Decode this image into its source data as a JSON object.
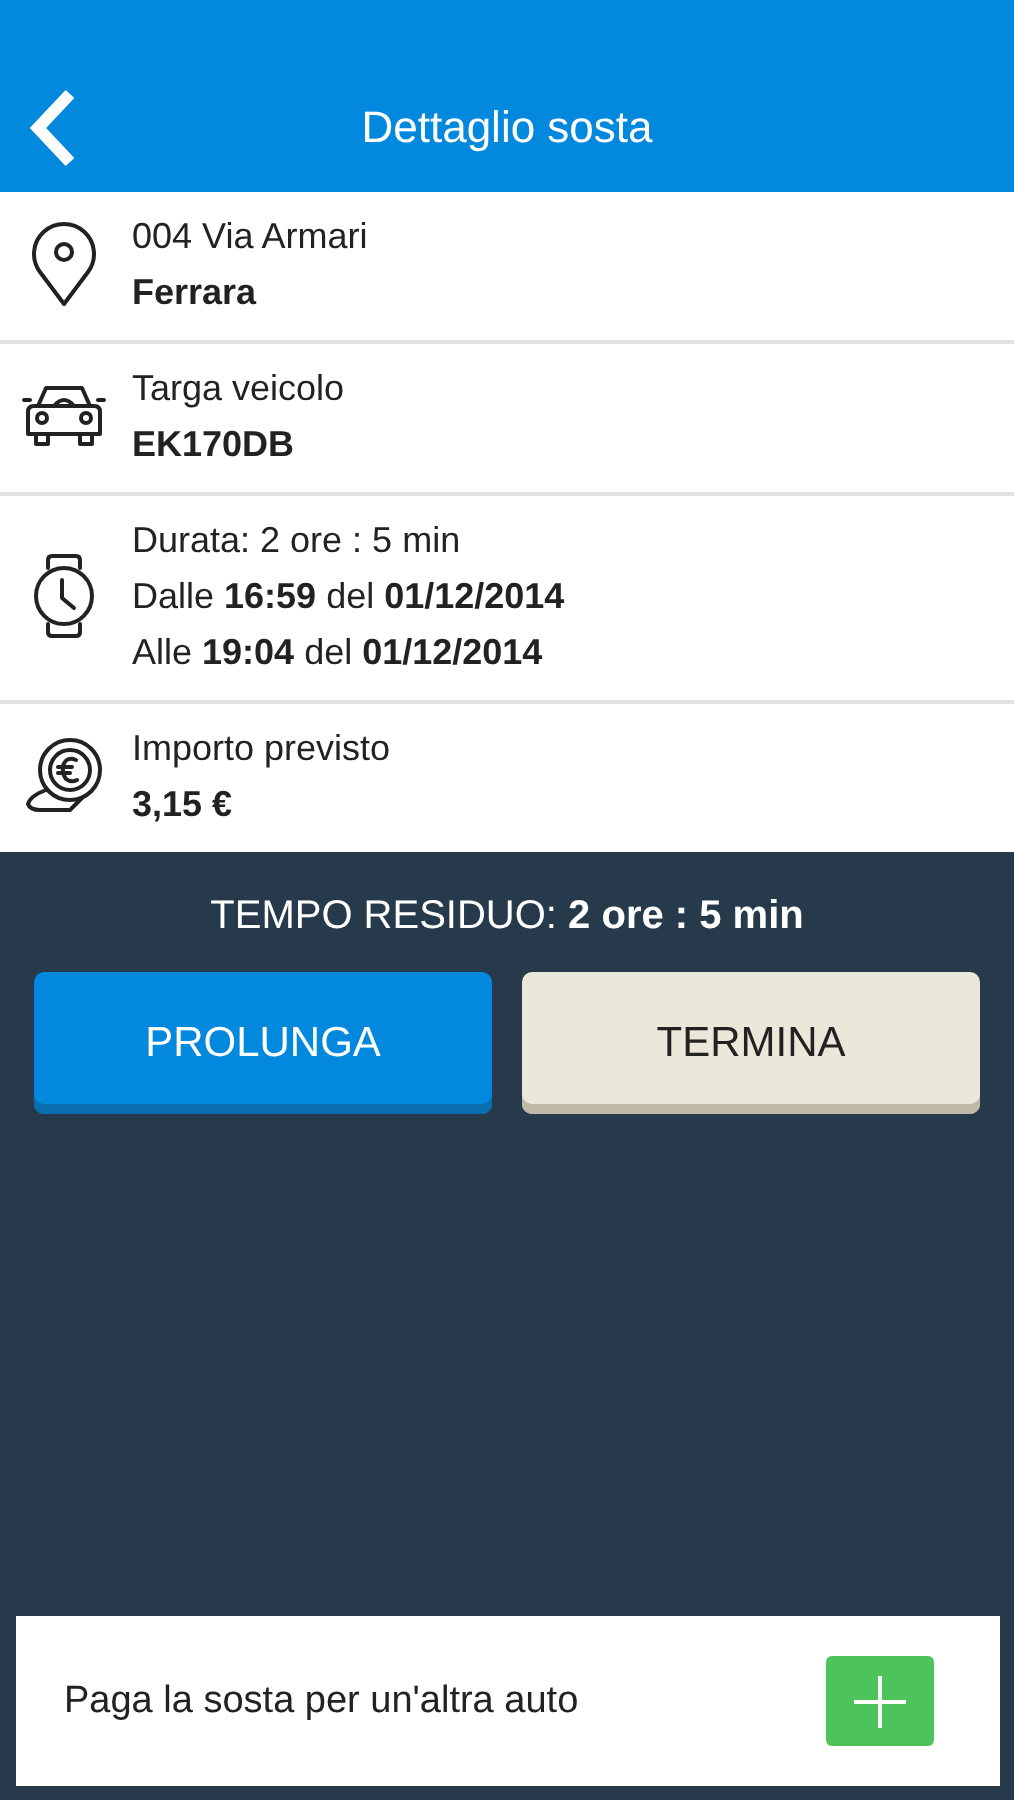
{
  "header": {
    "title": "Dettaglio sosta"
  },
  "details": [
    {
      "kind": "pin",
      "lines": [
        {
          "text": "004 Via Armari",
          "bold": false
        },
        {
          "text": "Ferrara",
          "bold": true
        }
      ]
    },
    {
      "kind": "car",
      "lines": [
        {
          "text": "Targa veicolo",
          "bold": false
        },
        {
          "text": "EK170DB",
          "bold": true
        }
      ]
    },
    {
      "kind": "watch",
      "lines": [
        {
          "text": "Durata: 2 ore : 5 min",
          "bold": false
        },
        {
          "text": "Dalle **16:59** del **01/12/2014**",
          "bold": false
        },
        {
          "text": "Alle **19:04** del **01/12/2014**",
          "bold": false
        }
      ]
    },
    {
      "kind": "coin",
      "lines": [
        {
          "text": "Importo previsto",
          "bold": false
        },
        {
          "text": "3,15 €",
          "bold": true
        }
      ]
    }
  ],
  "remaining": "TEMPO RESIDUO: **2 ore : 5 min**",
  "buttons": [
    {
      "label": "PROLUNGA",
      "kind": "primary"
    },
    {
      "label": "TERMINA",
      "kind": "secondary"
    }
  ],
  "footer": {
    "label": "Paga la sosta per un'altra auto"
  }
}
